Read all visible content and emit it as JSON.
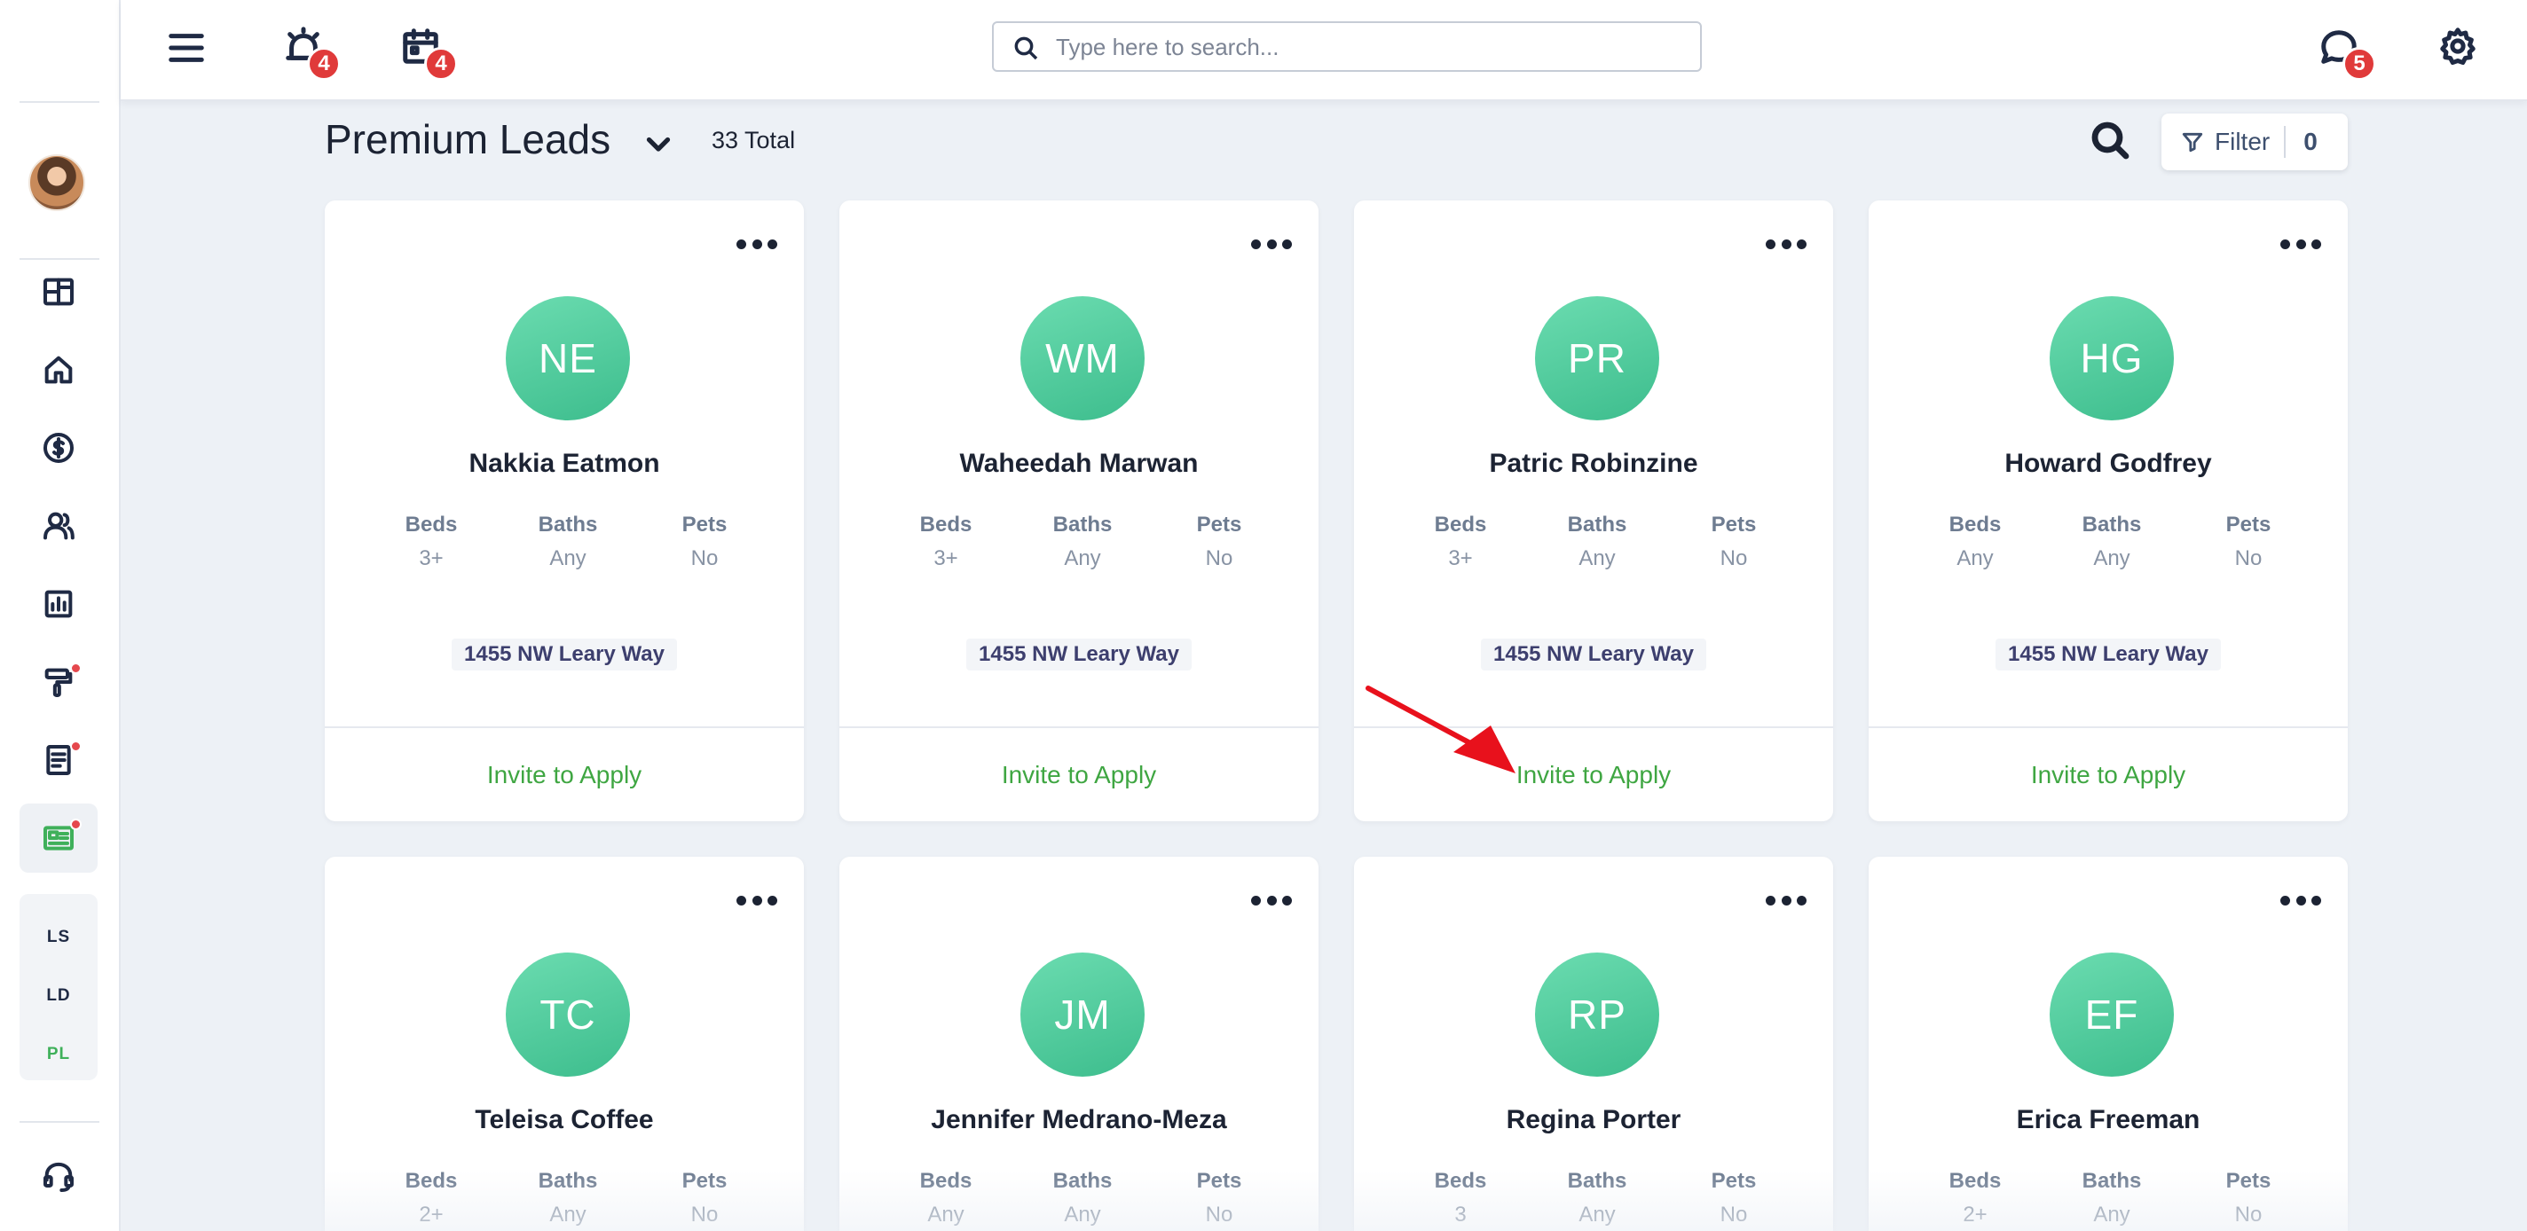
{
  "header": {
    "alerts_badge": "4",
    "calendar_badge": "4",
    "messages_badge": "5",
    "search_placeholder": "Type here to search..."
  },
  "sidebar": {
    "sub_nav": [
      "LS",
      "LD",
      "PL"
    ]
  },
  "toolbar": {
    "title": "Premium Leads",
    "total": "33 Total",
    "filter_label": "Filter",
    "filter_count": "0"
  },
  "labels": {
    "beds": "Beds",
    "baths": "Baths",
    "pets": "Pets",
    "invite": "Invite to Apply"
  },
  "leads": [
    {
      "initials": "NE",
      "name": "Nakkia Eatmon",
      "beds": "3+",
      "baths": "Any",
      "pets": "No",
      "address": "1455 NW Leary Way"
    },
    {
      "initials": "WM",
      "name": "Waheedah Marwan",
      "beds": "3+",
      "baths": "Any",
      "pets": "No",
      "address": "1455 NW Leary Way"
    },
    {
      "initials": "PR",
      "name": "Patric Robinzine",
      "beds": "3+",
      "baths": "Any",
      "pets": "No",
      "address": "1455 NW Leary Way"
    },
    {
      "initials": "HG",
      "name": "Howard Godfrey",
      "beds": "Any",
      "baths": "Any",
      "pets": "No",
      "address": "1455 NW Leary Way"
    },
    {
      "initials": "TC",
      "name": "Teleisa Coffee",
      "beds": "2+",
      "baths": "Any",
      "pets": "No"
    },
    {
      "initials": "JM",
      "name": "Jennifer Medrano-Meza",
      "beds": "Any",
      "baths": "Any",
      "pets": "No"
    },
    {
      "initials": "RP",
      "name": "Regina Porter",
      "beds": "3",
      "baths": "Any",
      "pets": "No"
    },
    {
      "initials": "EF",
      "name": "Erica Freeman",
      "beds": "2+",
      "baths": "Any",
      "pets": "No"
    }
  ],
  "colors": {
    "accent_green": "#3fa642",
    "avatar_green": "#4fcb9c",
    "badge_red": "#e03a3a",
    "annotation_red": "#e8111c"
  }
}
